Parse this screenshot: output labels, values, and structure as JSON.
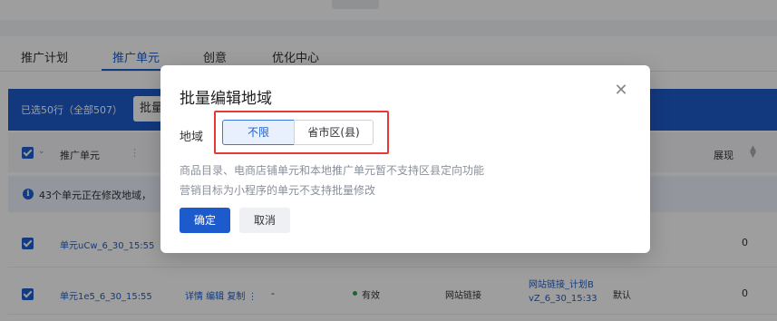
{
  "tabs": [
    {
      "label": "推广计划"
    },
    {
      "label": "推广单元"
    },
    {
      "label": "创意"
    },
    {
      "label": "优化中心"
    }
  ],
  "selection_bar": {
    "text": "已选50行（全部507）",
    "button_label": "批量"
  },
  "table": {
    "header_unit": "推广单元",
    "header_impressions": "展现",
    "notice": "43个单元正在修改地域，",
    "rows": [
      {
        "name": "单元uCw_6_30_15:55",
        "impressions": "0"
      },
      {
        "name": "单元1e5_6_30_15:55",
        "ops": "详情 编辑 复制 ⋮",
        "dash": "-",
        "status": "有效",
        "type": "网站链接",
        "link": "网站链接_计划B vZ_6_30_15:33",
        "default": "默认",
        "impressions": "0"
      }
    ]
  },
  "modal": {
    "title": "批量编辑地域",
    "field_label": "地域",
    "options": [
      "不限",
      "省市区(县)"
    ],
    "selected": "不限",
    "hints": [
      "商品目录、电商店铺单元和本地推广单元暂不支持区县定向功能",
      "营销目标为小程序的单元不支持批量修改"
    ],
    "confirm_label": "确定",
    "cancel_label": "取消"
  },
  "colors": {
    "primary": "#1d5bcc",
    "highlight_box": "#e53935"
  },
  "icons": {
    "close": "close-icon",
    "info": "info-icon",
    "checkbox": "checkbox-checked-icon"
  }
}
